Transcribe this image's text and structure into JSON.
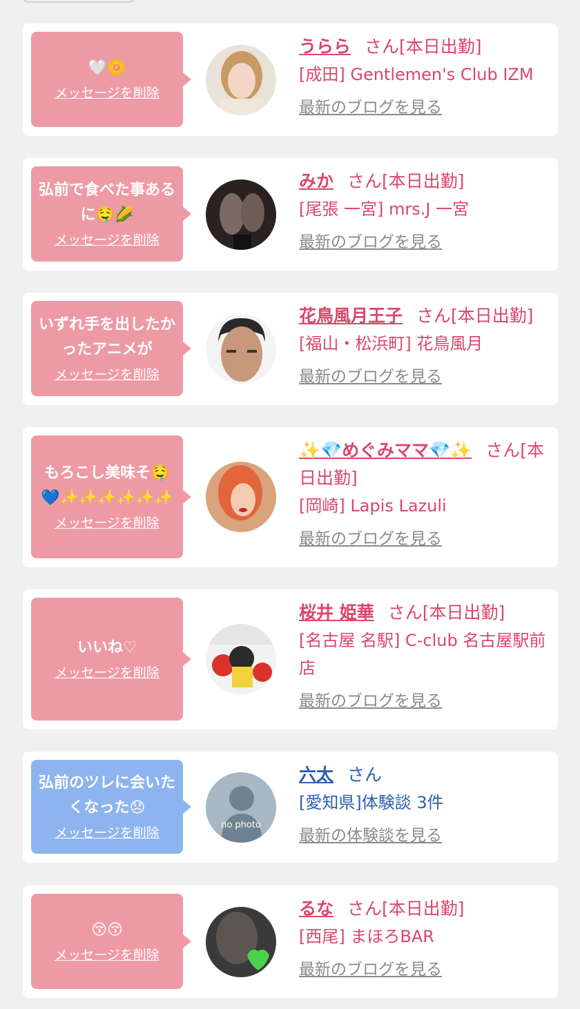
{
  "delete_label": "メッセージを削除",
  "colors": {
    "pink_bubble": "#ee9aa5",
    "blue_bubble": "#8db4ef",
    "cast_text": "#d9476a",
    "user_text": "#2b5fae",
    "link_gray": "#8a8a8a"
  },
  "entries": [
    {
      "message": "🤍🌼",
      "name": "うらら",
      "suffix": "さん[本日出勤]",
      "shop": "[成田] Gentlemen's Club IZM",
      "blog": "最新のブログを見る",
      "avatar": "avatar-photo"
    },
    {
      "message": "弘前で食べた事あるに🤤🌽",
      "name": "みか",
      "suffix": "さん[本日出勤]",
      "shop": "[尾張 一宮] mrs.J 一宮",
      "blog": "最新のブログを見る",
      "avatar": "avatar-photo"
    },
    {
      "message": "いずれ手を出したかったアニメが",
      "name": "花鳥風月王子",
      "suffix": "さん[本日出勤]",
      "shop": "[福山・松浜町] 花鳥風月",
      "blog": "最新のブログを見る",
      "avatar": "avatar-photo"
    },
    {
      "message": "もろこし美味そ🤤💙✨✨✨✨✨✨",
      "name": "✨💎めぐみママ💎✨",
      "suffix": "さん[本日出勤]",
      "shop": "[岡崎] Lapis Lazuli",
      "blog": "最新のブログを見る",
      "avatar": "avatar-photo"
    },
    {
      "message": "いいね♡",
      "name": "桜井 姫華",
      "suffix": "さん[本日出勤]",
      "shop": "[名古屋 名駅] C-club 名古屋駅前店",
      "blog": "最新のブログを見る",
      "avatar": "avatar-photo"
    },
    {
      "message": "弘前のツレに会いたくなった😞",
      "name": "六太",
      "suffix": "さん",
      "shop": "[愛知県]体験談 3件",
      "blog": "最新の体験談を見る",
      "avatar": "no photo"
    },
    {
      "message": "😚😚",
      "name": "るな",
      "suffix": "さん[本日出勤]",
      "shop": "[西尾] まほろBAR",
      "blog": "最新のブログを見る",
      "avatar": "avatar-photo"
    }
  ]
}
